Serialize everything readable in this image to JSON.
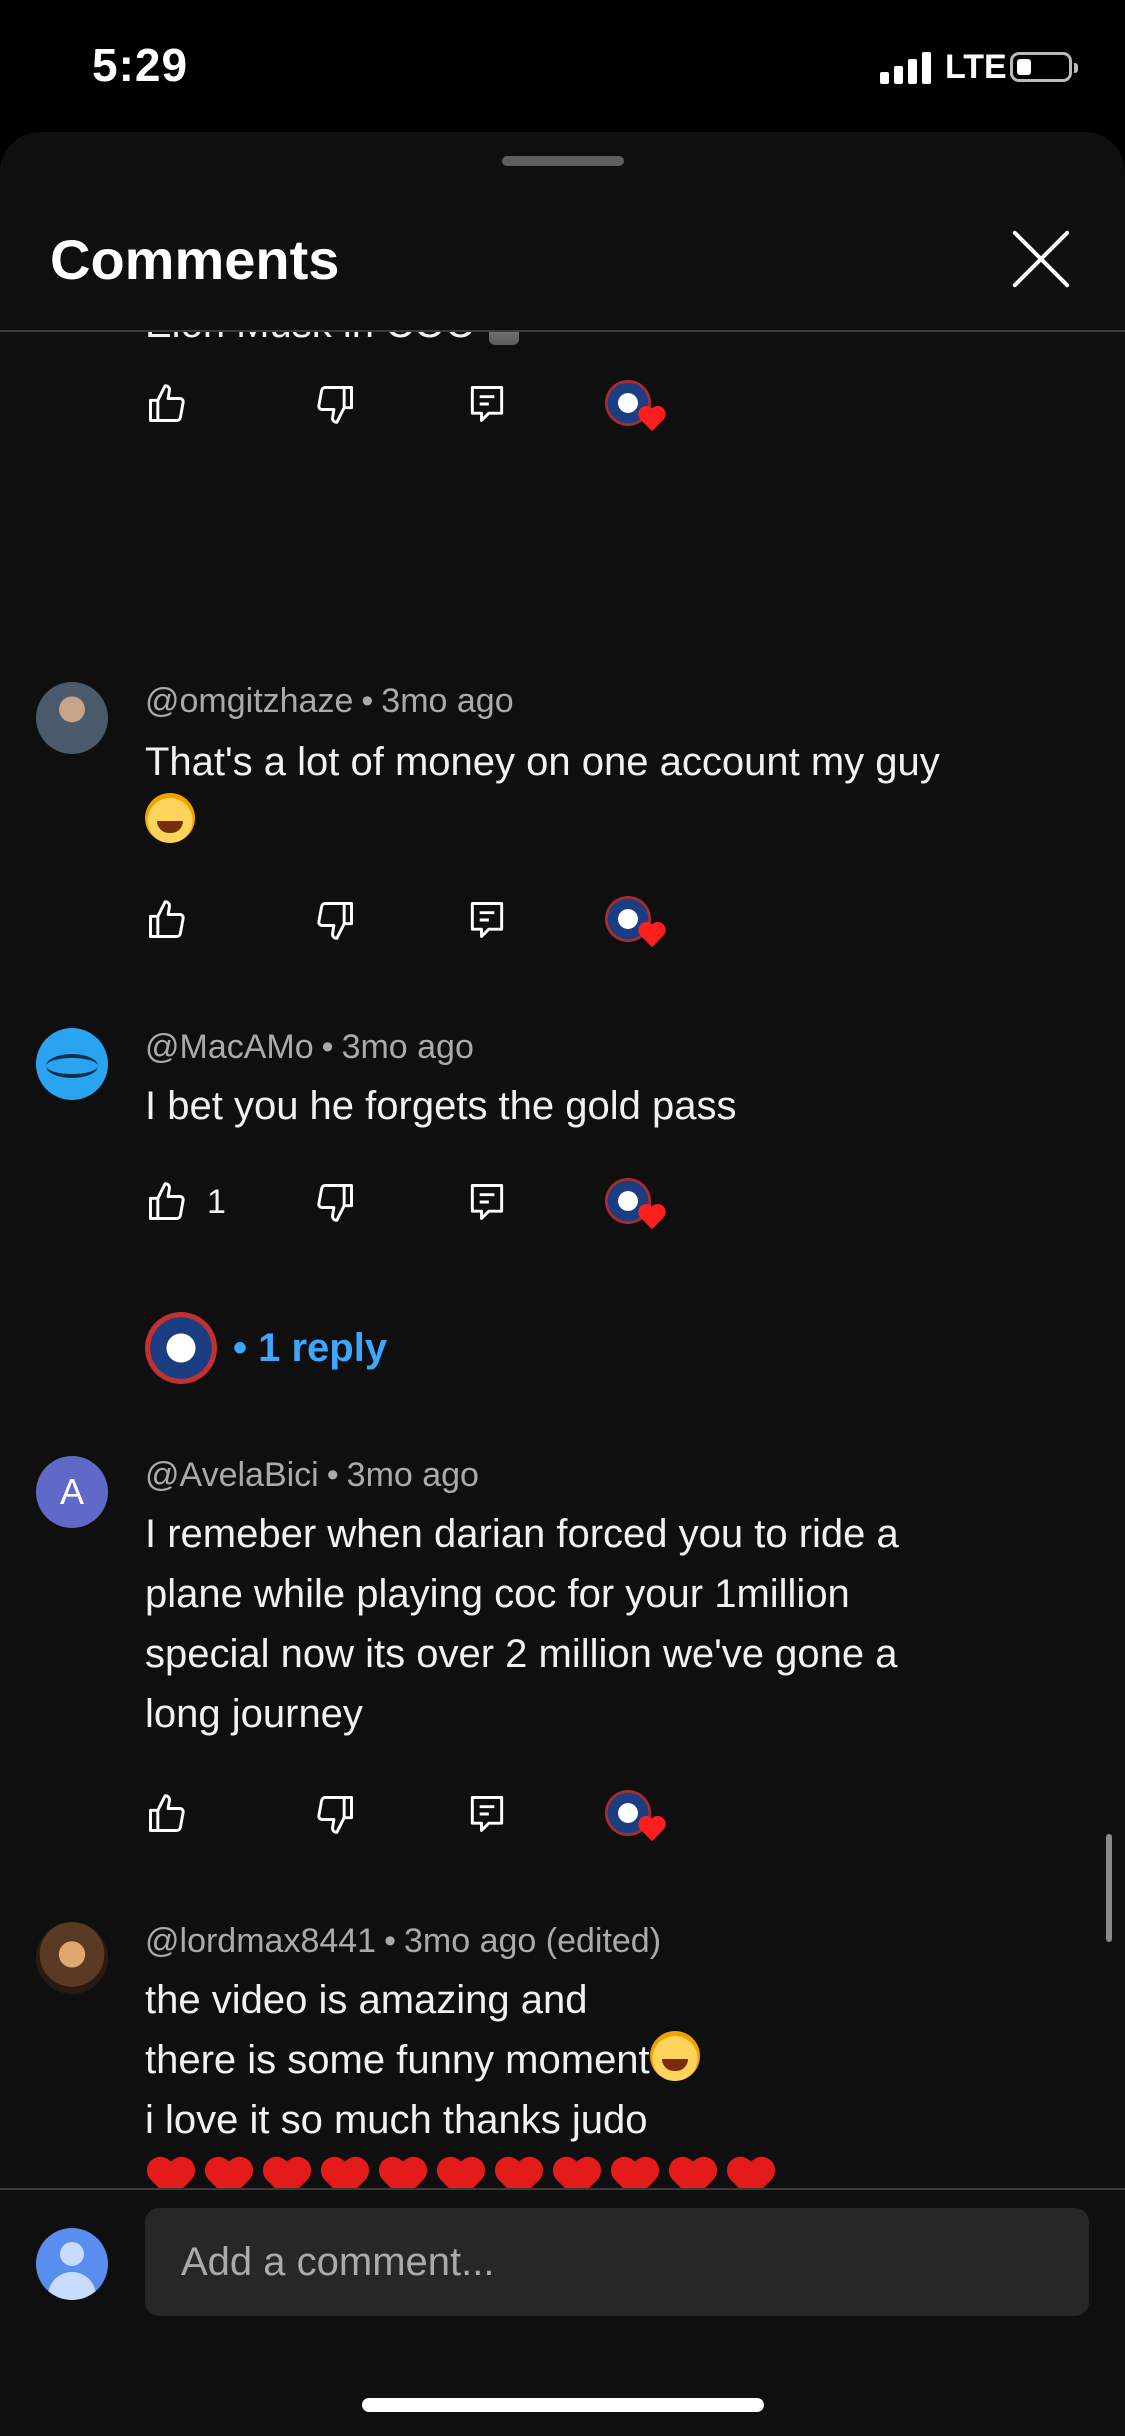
{
  "status_bar": {
    "time": "5:29",
    "network": "LTE"
  },
  "sheet": {
    "title": "Comments"
  },
  "partial_comment": {
    "text": "Elon Musk in COC"
  },
  "comments": [
    {
      "author": "@omgitzhaze",
      "age": "3mo ago",
      "lines": [
        "That's a lot of money on one account my guy"
      ],
      "like_count": ""
    },
    {
      "author": "@MacAMo",
      "age": "3mo ago",
      "lines": [
        "I bet you he forgets the gold pass"
      ],
      "like_count": "1",
      "replies": "1 reply"
    },
    {
      "author": "@AvelaBici",
      "avatar_letter": "A",
      "age": "3mo ago",
      "lines": [
        "I remeber when darian forced you to ride a",
        "plane while playing coc for your 1million",
        "special now its over 2 million we've gone a",
        "long journey"
      ],
      "like_count": ""
    },
    {
      "author": "@lordmax8441",
      "age": "3mo ago (edited)",
      "lines": [
        "the video is amazing and",
        "there is some funny moment",
        "i love it so much thanks judo"
      ],
      "like_count": ""
    }
  ],
  "composer": {
    "placeholder": "Add a comment..."
  },
  "colors": {
    "background": "#0f0f0f",
    "link": "#3ea6ff",
    "muted_text": "#aaaaaa"
  },
  "icons": [
    "close-icon",
    "like-icon",
    "dislike-icon",
    "reply-icon",
    "creator-heart-icon",
    "heart-emoji",
    "laughing-emoji"
  ]
}
